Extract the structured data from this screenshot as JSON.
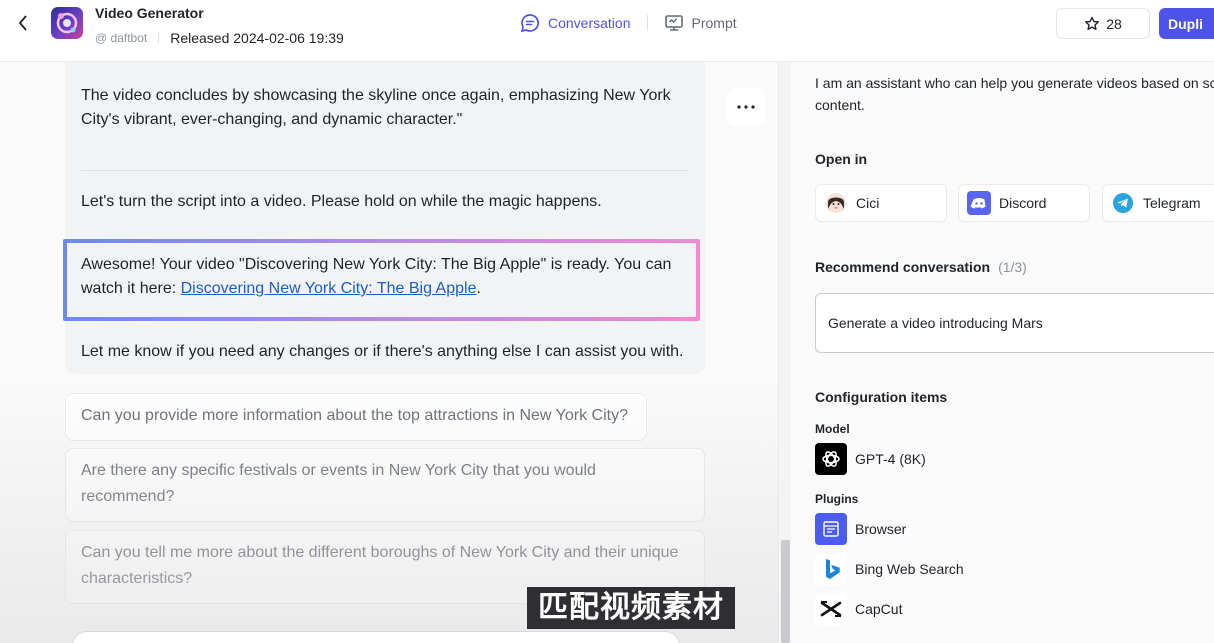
{
  "header": {
    "bot_name": "Video Generator",
    "handle": "@ daftbot",
    "released": "Released 2024-02-06 19:39",
    "modes": {
      "conversation": "Conversation",
      "prompt": "Prompt"
    },
    "star_count": "28",
    "duplicate_label": "Dupli"
  },
  "chat": {
    "paragraph_1": "The video concludes by showcasing the skyline once again, emphasizing New York City's vibrant, ever-changing, and dynamic character.\"",
    "paragraph_2": "Let's turn the script into a video. Please hold on while the magic happens.",
    "highlight_text": "Awesome! Your video \"Discovering New York City: The Big Apple\" is ready. You can watch it here: ",
    "link_text": "Discovering New York City: The Big Apple",
    "link_suffix": ".",
    "paragraph_4": "Let me know if you need any changes or if there's anything else I can assist you with.",
    "suggestions": [
      "Can you provide more information about the top attractions in New York City?",
      "Are there any specific festivals or events in New York City that you would recommend?",
      "Can you tell me more about the different boroughs of New York City and their unique characteristics?"
    ]
  },
  "panel": {
    "description": "I am an assistant who can help you generate videos based on sc content.",
    "open_in_title": "Open in",
    "open_in": [
      "Cici",
      "Discord",
      "Telegram"
    ],
    "recommend_title": "Recommend conversation",
    "recommend_count": "(1/3)",
    "recommend_item": "Generate a video introducing Mars",
    "config_title": "Configuration items",
    "model_label": "Model",
    "model_name": "GPT-4 (8K)",
    "plugins_label": "Plugins",
    "plugins": [
      "Browser",
      "Bing Web Search",
      "CapCut"
    ]
  },
  "overlay_caption": "匹配视频素材",
  "colors": {
    "accent": "#4d53e8",
    "link": "#1a5fc4",
    "discord": "#5865f2",
    "telegram": "#2aa3df"
  }
}
